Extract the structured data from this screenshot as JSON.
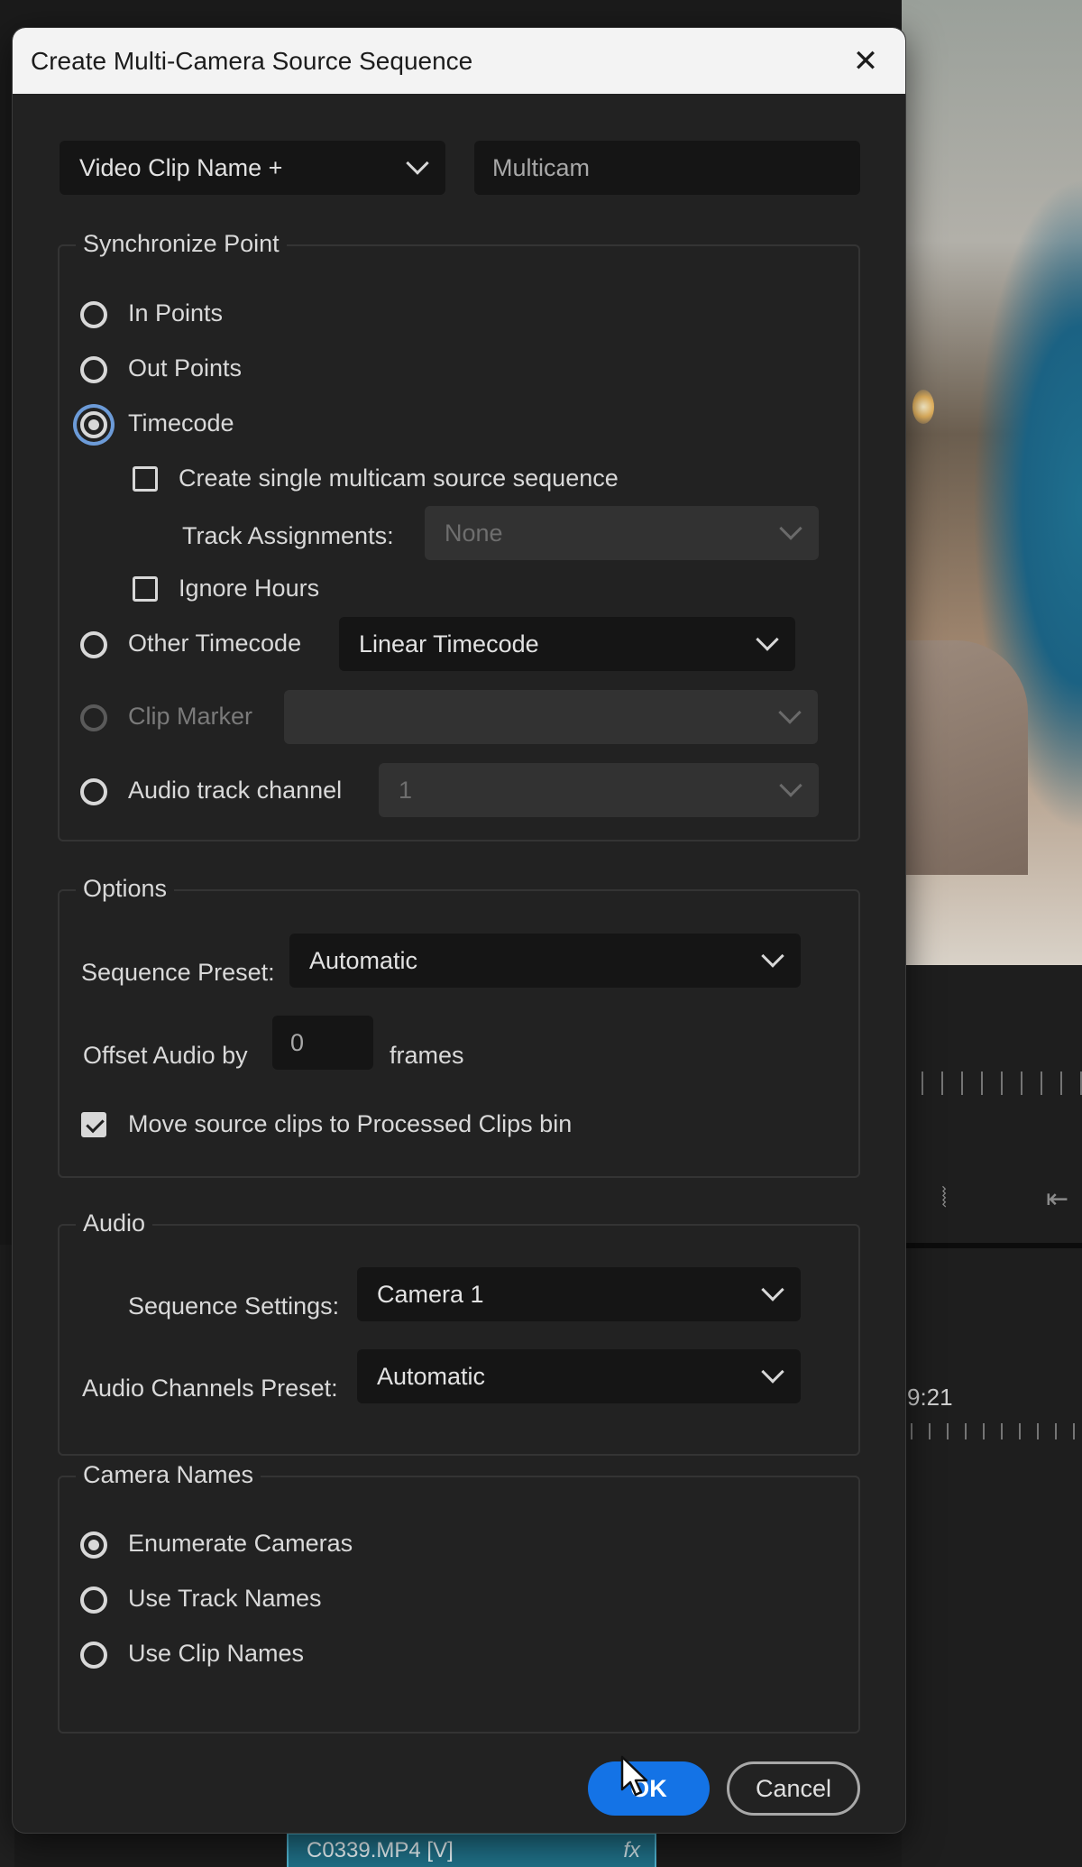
{
  "dialog": {
    "title": "Create Multi-Camera Source Sequence",
    "name_format": "Video Clip Name +",
    "name_value": "Multicam"
  },
  "sync": {
    "title": "Synchronize Point",
    "in_points": "In Points",
    "out_points": "Out Points",
    "timecode": "Timecode",
    "create_single": "Create single multicam source sequence",
    "track_assignments_label": "Track Assignments:",
    "track_assignments_value": "None",
    "ignore_hours": "Ignore Hours",
    "other_timecode": "Other Timecode",
    "other_timecode_value": "Linear Timecode",
    "clip_marker": "Clip Marker",
    "clip_marker_value": "",
    "audio_track_channel": "Audio track channel",
    "audio_track_channel_value": "1",
    "selected": "timecode"
  },
  "options": {
    "title": "Options",
    "sequence_preset_label": "Sequence Preset:",
    "sequence_preset_value": "Automatic",
    "offset_audio_label": "Offset Audio by",
    "offset_audio_value": "0",
    "offset_audio_unit": "frames",
    "move_source_clips": "Move source clips to Processed Clips bin",
    "move_source_clips_checked": true
  },
  "audio": {
    "title": "Audio",
    "sequence_settings_label": "Sequence Settings:",
    "sequence_settings_value": "Camera 1",
    "channels_preset_label": "Audio Channels Preset:",
    "channels_preset_value": "Automatic"
  },
  "camera_names": {
    "title": "Camera Names",
    "enumerate": "Enumerate Cameras",
    "track_names": "Use Track Names",
    "clip_names": "Use Clip Names",
    "selected": "enumerate"
  },
  "buttons": {
    "ok": "OK",
    "cancel": "Cancel"
  },
  "background": {
    "timecode": "9:21",
    "clip_label": "C0339.MP4 [V]",
    "clip_fx": "fx"
  },
  "colors": {
    "accent": "#1473e6",
    "focus_ring": "#6c9bd8",
    "dialog_bg": "#222222",
    "clip_bg": "#1f6f86"
  }
}
